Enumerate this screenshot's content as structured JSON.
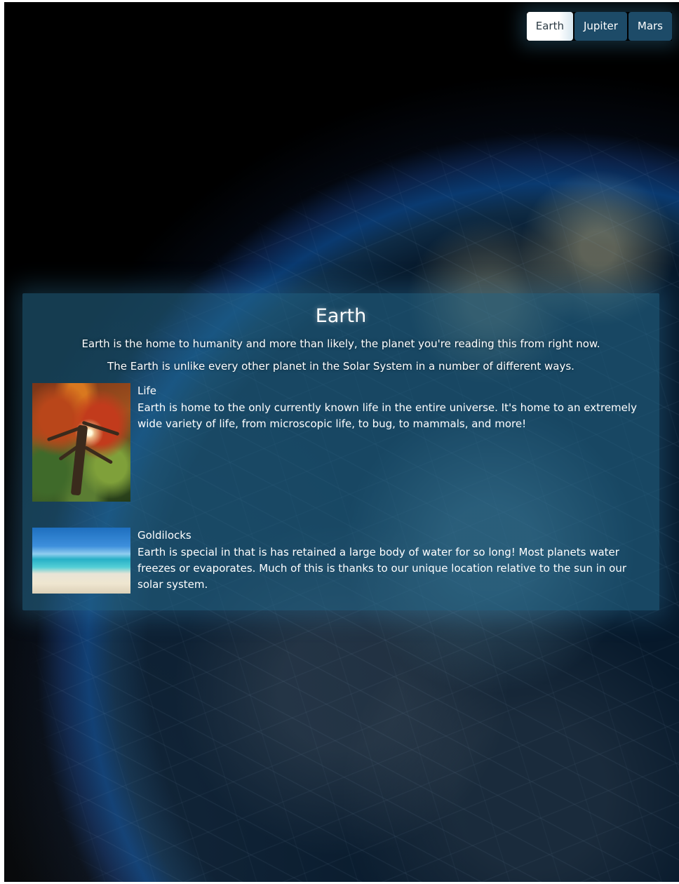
{
  "nav": {
    "items": [
      {
        "label": "Earth",
        "active": true
      },
      {
        "label": "Jupiter",
        "active": false
      },
      {
        "label": "Mars",
        "active": false
      }
    ]
  },
  "panel": {
    "title": "Earth",
    "intro": [
      "Earth is the home to humanity and more than likely, the planet you're reading this from right now.",
      "The Earth is unlike every other planet in the Solar System in a number of different ways."
    ],
    "features": [
      {
        "image": "autumn-tree-image",
        "heading": "Life",
        "text": "Earth is home to the only currently known life in the entire universe. It's home to an extremely wide variety of life, from microscopic life, to bug, to mammals, and more!"
      },
      {
        "image": "beach-image",
        "heading": "Goldilocks",
        "text": "Earth is special in that is has retained a large body of water for so long! Most planets water freezes or evaporates. Much of this is thanks to our unique location relative to the sun in our solar system."
      }
    ]
  },
  "colors": {
    "panel_bg": "#266e91",
    "nav_button_bg": "#1d4b68",
    "nav_active_bg": "#ffffff",
    "text": "#ffffff"
  }
}
